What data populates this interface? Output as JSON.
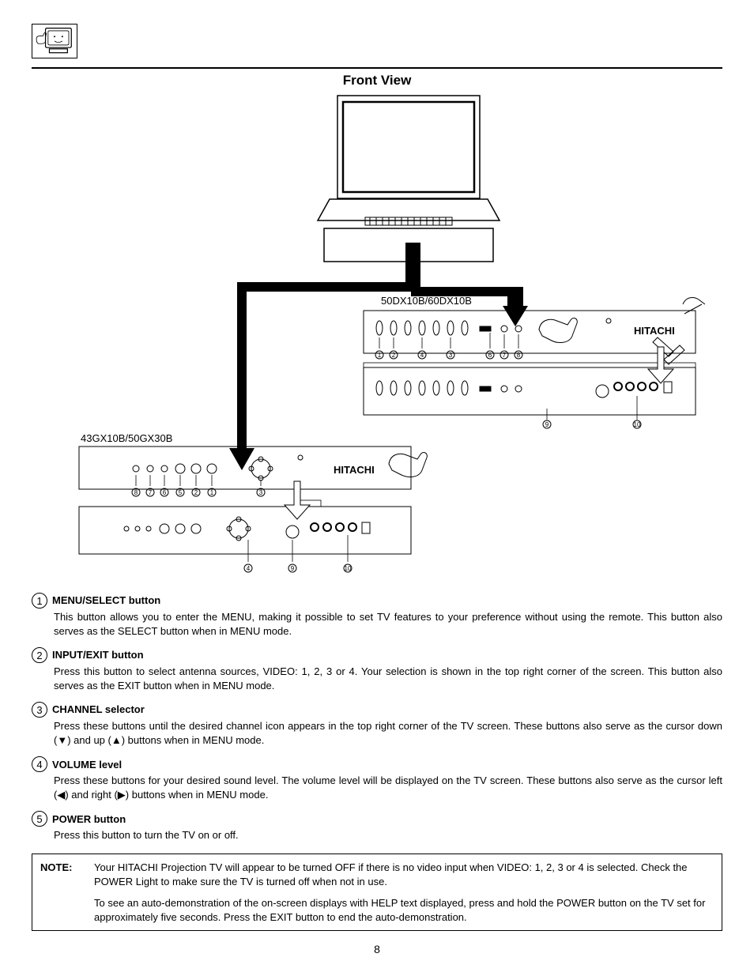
{
  "page": {
    "title": "Front View",
    "number": "8"
  },
  "diagram": {
    "model1": "50DX10B/60DX10B",
    "model2": "43GX10B/50GX30B",
    "brand": "HITACHI",
    "panel_callouts_a": [
      "①",
      "②",
      "④",
      "③",
      "⑥",
      "⑦",
      "⑧"
    ],
    "panel_callouts_b": [
      "⑨",
      "⑩"
    ],
    "panel_callouts_c": [
      "⑧",
      "⑦",
      "⑥",
      "⑤",
      "②",
      "①",
      "③"
    ],
    "panel_callouts_d": [
      "④",
      "⑨",
      "⑩"
    ]
  },
  "items": [
    {
      "num": "1",
      "title": "MENU/SELECT button",
      "body": "This button allows you to enter the MENU, making it possible to set TV features to your preference without using the remote.  This button also serves as the SELECT button when in MENU mode."
    },
    {
      "num": "2",
      "title": "INPUT/EXIT button",
      "body": "Press this button to select antenna sources, VIDEO: 1, 2, 3 or 4.  Your selection is shown in the top right corner of the screen.  This button also serves as the EXIT button when in MENU mode."
    },
    {
      "num": "3",
      "title": "CHANNEL selector",
      "body": "Press these buttons until the desired channel icon appears in the top right corner of the TV screen.  These buttons also serve as the cursor down (▼) and up (▲) buttons when in MENU mode."
    },
    {
      "num": "4",
      "title": "VOLUME level",
      "body": "Press these buttons for your desired sound level.  The volume level will be displayed on the TV screen.  These buttons also serve as the cursor left (◀) and right (▶) buttons when in MENU mode."
    },
    {
      "num": "5",
      "title": "POWER button",
      "body": "Press this button to turn the TV on or off."
    }
  ],
  "note": {
    "label": "NOTE:",
    "p1": "Your HITACHI Projection TV will appear to be turned OFF if there is no video input when VIDEO: 1, 2, 3 or 4 is selected.  Check the POWER Light to make sure the TV is turned off when not in use.",
    "p2": "To see an auto-demonstration of the on-screen displays with HELP text displayed, press and hold the POWER button on the TV set for approximately five seconds.  Press the EXIT button to end the auto-demonstration."
  }
}
